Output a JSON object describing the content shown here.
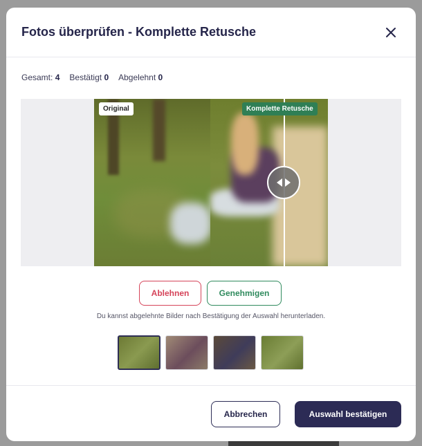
{
  "modal": {
    "title": "Fotos überprüfen - Komplette Retusche"
  },
  "stats": {
    "total_label": "Gesamt:",
    "total_value": "4",
    "confirmed_label": "Bestätigt",
    "confirmed_value": "0",
    "rejected_label": "Abgelehnt",
    "rejected_value": "0"
  },
  "viewer": {
    "original_badge": "Original",
    "retouched_badge": "Komplette Retusche"
  },
  "actions": {
    "reject_label": "Ablehnen",
    "approve_label": "Genehmigen",
    "hint": "Du kannst abgelehnte Bilder nach Bestätigung der Auswahl herunterladen."
  },
  "thumbnails": [
    {
      "active": true
    },
    {
      "active": false
    },
    {
      "active": false
    },
    {
      "active": false
    }
  ],
  "footer": {
    "cancel_label": "Abbrechen",
    "confirm_label": "Auswahl bestätigen"
  },
  "colors": {
    "primary": "#2c2b55",
    "reject": "#d54359",
    "approve": "#2f8a5d",
    "retouch_badge": "#2f7f55"
  }
}
